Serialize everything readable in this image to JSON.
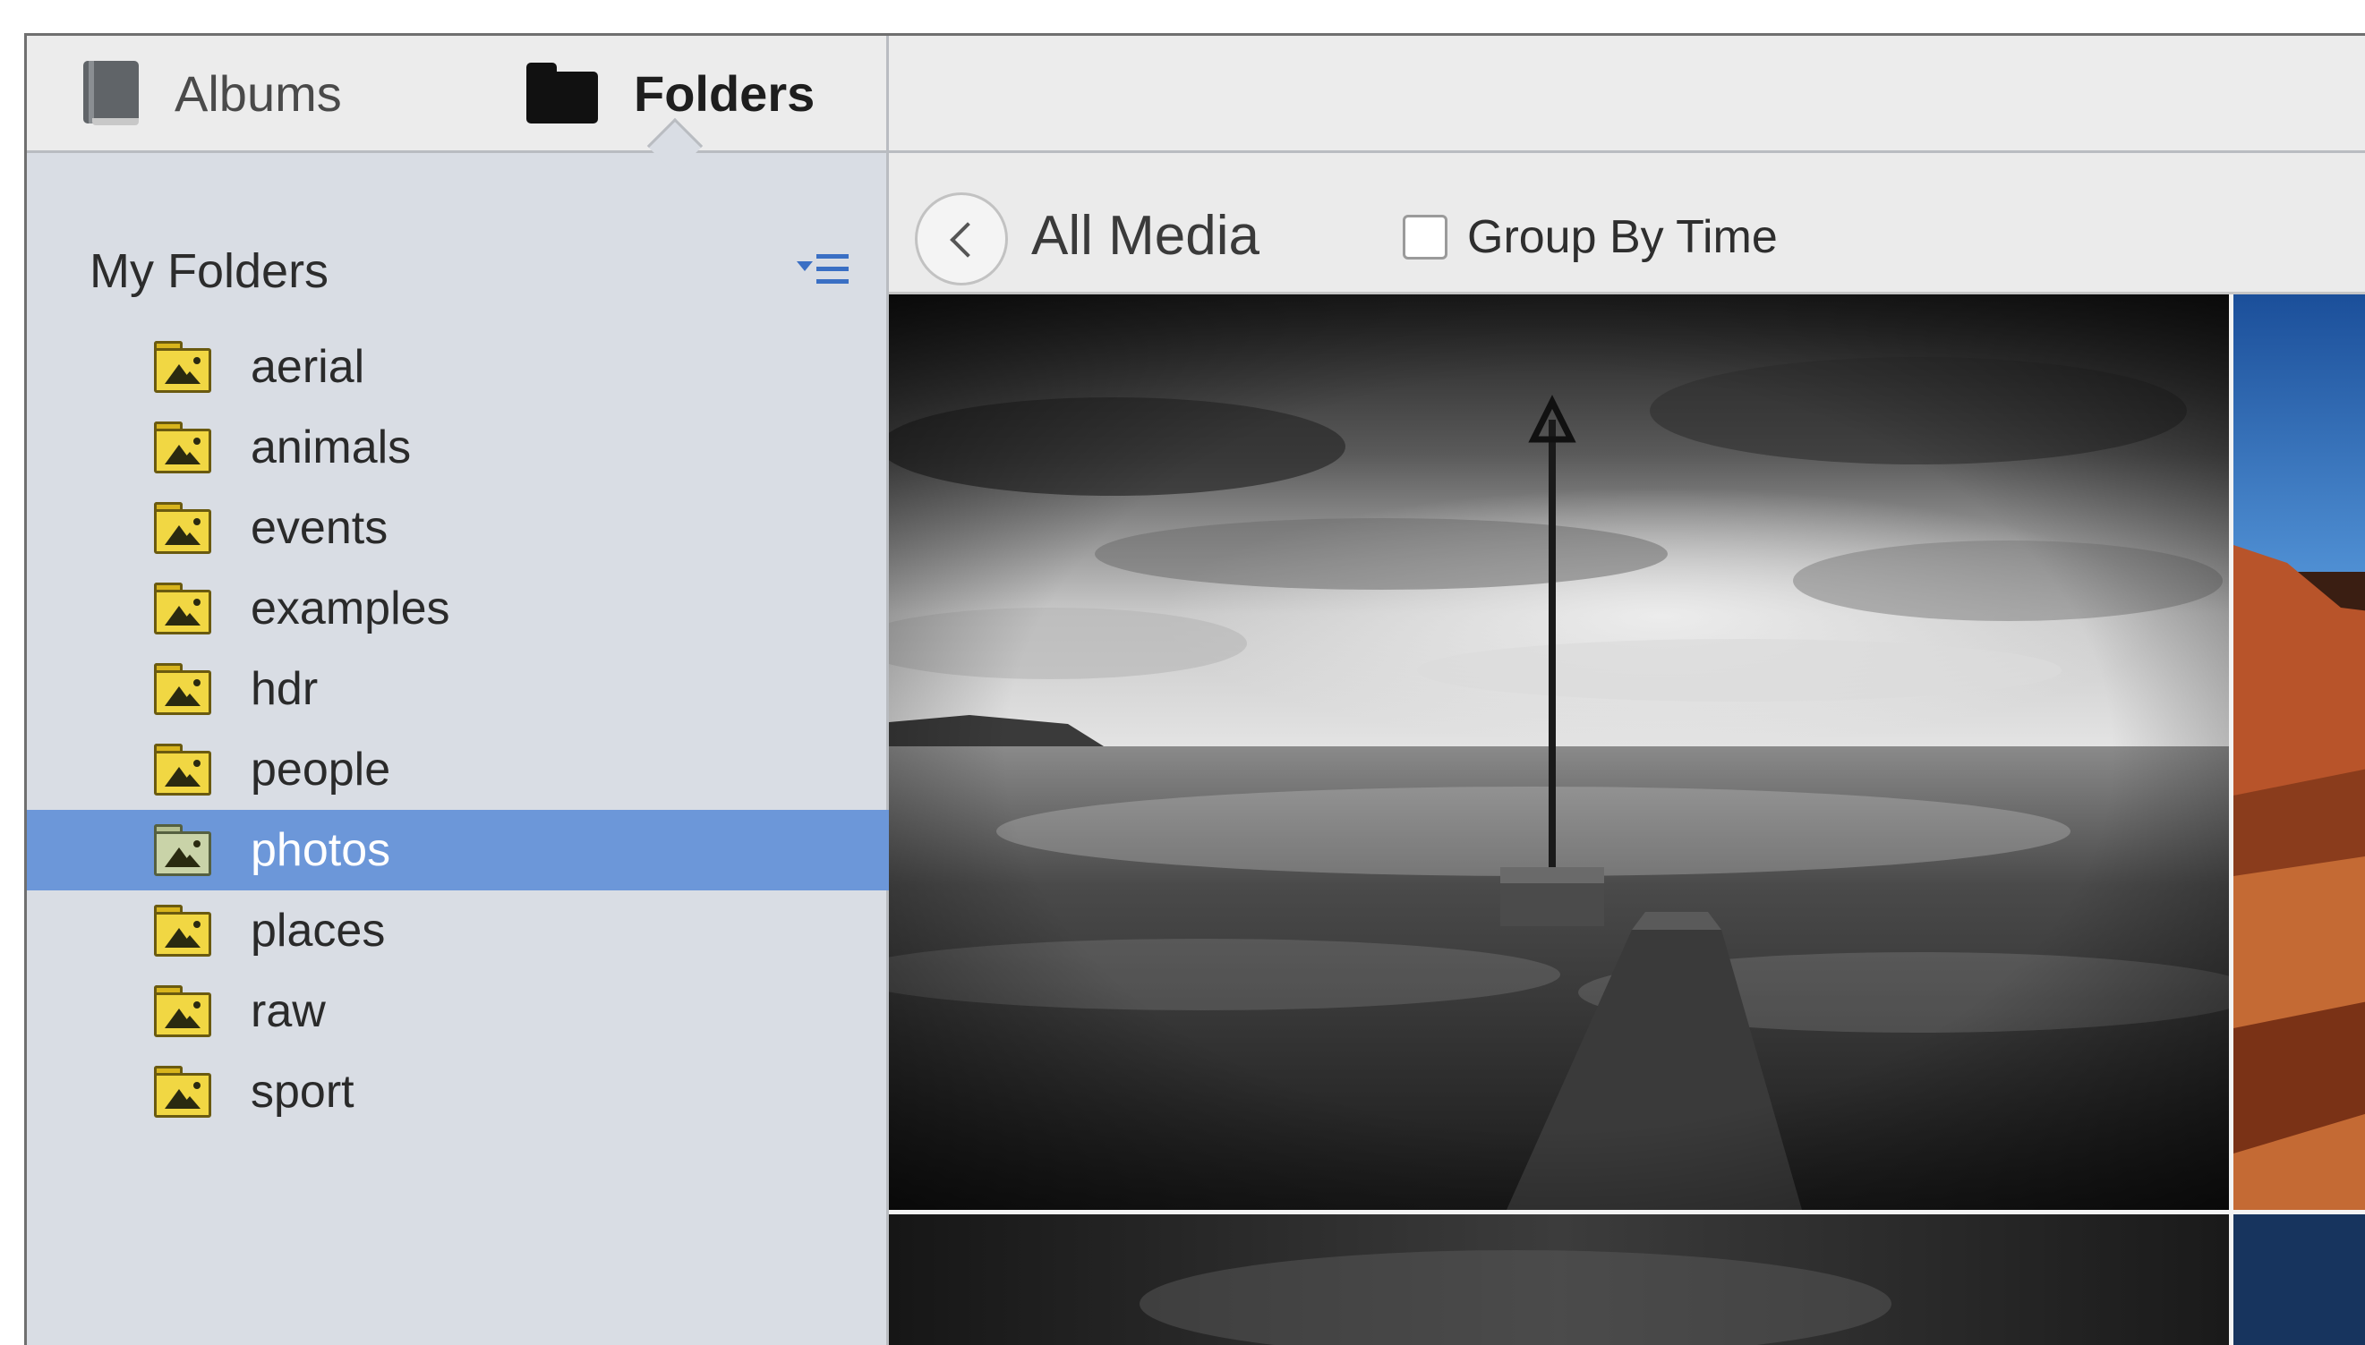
{
  "tabs": [
    {
      "label": "Albums",
      "icon": "book-icon",
      "active": false
    },
    {
      "label": "Folders",
      "icon": "folder-icon",
      "active": true
    }
  ],
  "sidebar": {
    "header": "My Folders",
    "menu_icon": "list-options-icon",
    "folders": [
      {
        "label": "aerial",
        "selected": false
      },
      {
        "label": "animals",
        "selected": false
      },
      {
        "label": "events",
        "selected": false
      },
      {
        "label": "examples",
        "selected": false
      },
      {
        "label": "hdr",
        "selected": false
      },
      {
        "label": "people",
        "selected": false
      },
      {
        "label": "photos",
        "selected": true
      },
      {
        "label": "places",
        "selected": false
      },
      {
        "label": "raw",
        "selected": false
      },
      {
        "label": "sport",
        "selected": false
      }
    ]
  },
  "main": {
    "back_icon": "chevron-left-icon",
    "title": "All Media",
    "group_by_time": {
      "label": "Group By Time",
      "checked": false
    }
  },
  "colors": {
    "selection": "#6c97d9",
    "sidebar_bg": "#d9dde4",
    "accent": "#3a6fc4"
  }
}
